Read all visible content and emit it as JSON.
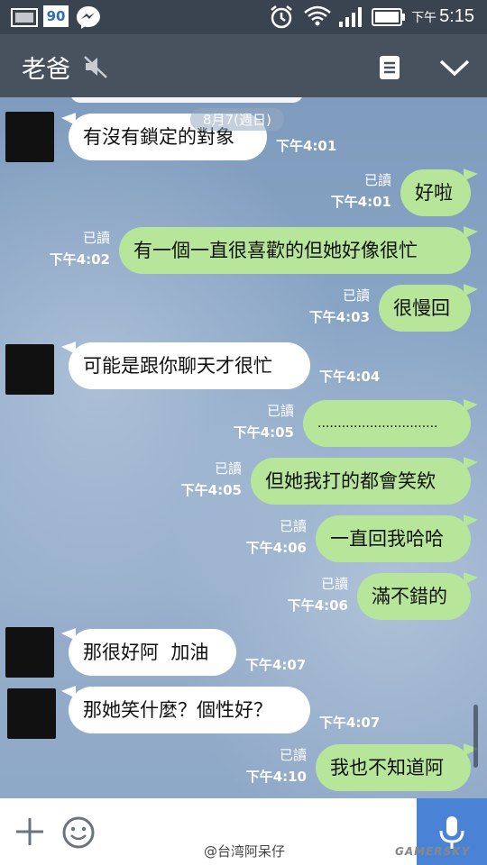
{
  "status_bar": {
    "badge": "90",
    "ampm": "下午",
    "time": "5:15"
  },
  "header": {
    "title": "老爸"
  },
  "date_divider": "8月7(週日)",
  "read_label": "已讀",
  "messages": [
    {
      "side": "in",
      "text": "有沒有鎖定的對象",
      "time": "下午4:01"
    },
    {
      "side": "out",
      "text": "好啦",
      "time": "下午4:01"
    },
    {
      "side": "out",
      "text": "有一個一直很喜歡的但她好像很忙",
      "time": "下午4:02"
    },
    {
      "side": "out",
      "text": "很慢回",
      "time": "下午4:03"
    },
    {
      "side": "in",
      "text": "可能是跟你聊天才很忙",
      "time": "下午4:04"
    },
    {
      "side": "out",
      "text": "..............................",
      "time": "下午4:05"
    },
    {
      "side": "out",
      "text": "但她我打的都會笑欸",
      "time": "下午4:05"
    },
    {
      "side": "out",
      "text": "一直回我哈哈",
      "time": "下午4:06"
    },
    {
      "side": "out",
      "text": "滿不錯的",
      "time": "下午4:06"
    },
    {
      "side": "in",
      "text": "那很好阿  加油",
      "time": "下午4:07"
    },
    {
      "side": "in",
      "text": "那她笑什麼？個性好？",
      "time": "下午4:07"
    },
    {
      "side": "out",
      "text": "我也不知道阿",
      "time": "下午4:10"
    }
  ],
  "watermark": "@台湾阿呆仔",
  "watermark_site": "GAMERSKY"
}
